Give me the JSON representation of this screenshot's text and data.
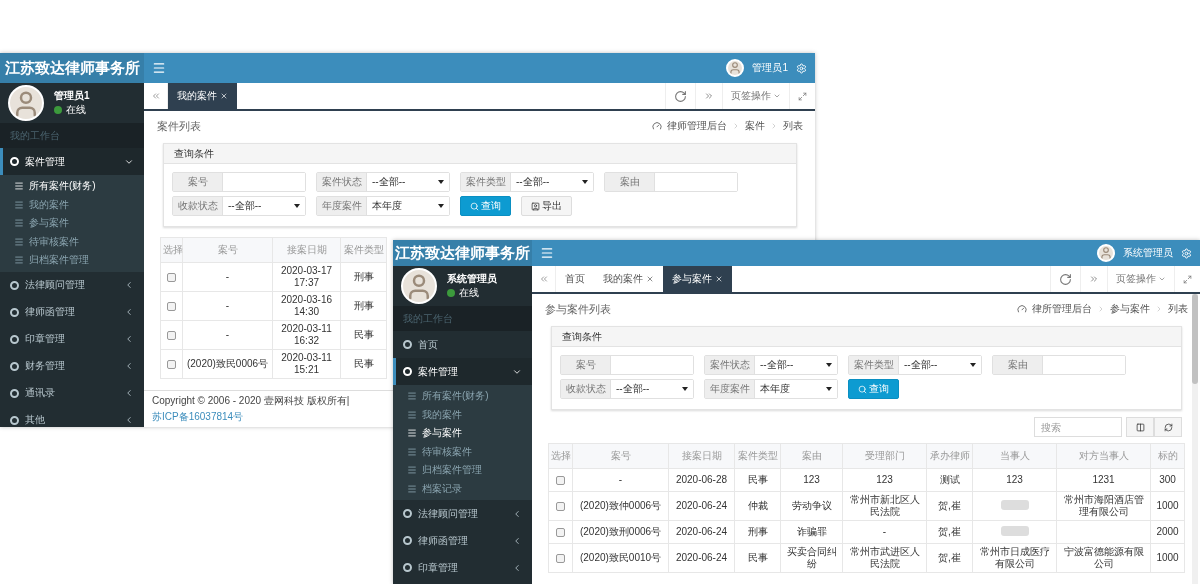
{
  "windows": [
    {
      "brand": "江苏致达律师事务所",
      "header_user": "管理员1",
      "user": {
        "name": "管理员1",
        "status": "在线",
        "online": true
      },
      "workspace_label": "我的工作台",
      "menu": [
        {
          "label": "案件管理",
          "selected": true,
          "expanded": true,
          "children": [
            {
              "label": "所有案件(财务)",
              "selected": true
            },
            {
              "label": "我的案件",
              "selected": false
            },
            {
              "label": "参与案件",
              "selected": false
            },
            {
              "label": "待审核案件",
              "selected": false
            },
            {
              "label": "归档案件管理",
              "selected": false
            }
          ]
        },
        {
          "label": "法律顾问管理",
          "selected": false,
          "expanded": false
        },
        {
          "label": "律师函管理",
          "selected": false,
          "expanded": false
        },
        {
          "label": "印章管理",
          "selected": false,
          "expanded": false
        },
        {
          "label": "财务管理",
          "selected": false,
          "expanded": false
        },
        {
          "label": "通讯录",
          "selected": false,
          "expanded": false
        },
        {
          "label": "其他",
          "selected": false,
          "expanded": false
        }
      ],
      "tabs": [
        {
          "label": "我的案件",
          "selected": true,
          "closable": true
        }
      ],
      "tab_actions": "页签操作",
      "page_title": "案件列表",
      "breadcrumb": [
        "律师管理后台",
        "案件",
        "列表"
      ],
      "query": {
        "title": "查询条件",
        "rows": [
          [
            {
              "kind": "input",
              "label": "案号"
            },
            {
              "kind": "select",
              "label": "案件状态",
              "value": "--全部--"
            },
            {
              "kind": "select",
              "label": "案件类型",
              "value": "--全部--"
            },
            {
              "kind": "input",
              "label": "案由"
            }
          ],
          [
            {
              "kind": "select",
              "label": "收款状态",
              "value": "--全部--"
            },
            {
              "kind": "select",
              "label": "年度案件",
              "value": "本年度"
            },
            {
              "kind": "search_button",
              "label": "查询"
            },
            {
              "kind": "export_button",
              "label": "导出"
            }
          ]
        ]
      },
      "table": {
        "columns": [
          "选择",
          "案号",
          "接案日期",
          "案件类型"
        ],
        "rows": [
          {
            "cells": [
              {
                "kind": "checkbox",
                "checked": false
              },
              "-",
              "2020-03-17 17:37",
              "刑事"
            ]
          },
          {
            "cells": [
              {
                "kind": "checkbox",
                "checked": false
              },
              "-",
              "2020-03-16 14:30",
              "刑事"
            ]
          },
          {
            "cells": [
              {
                "kind": "checkbox",
                "checked": false
              },
              "-",
              "2020-03-11 16:32",
              "民事"
            ]
          },
          {
            "cells": [
              {
                "kind": "checkbox",
                "checked": false
              },
              "(2020)致民0006号",
              "2020-03-11 15:21",
              "民事"
            ]
          }
        ]
      },
      "footer": {
        "text": "Copyright © 2006 - 2020 壹网科技 版权所有|",
        "link": "苏ICP备16037814号"
      }
    },
    {
      "brand": "江苏致达律师事务所",
      "header_user": "系统管理员",
      "user": {
        "name": "系统管理员",
        "status": "在线",
        "online": true
      },
      "workspace_label": "我的工作台",
      "menu": [
        {
          "label": "首页",
          "selected": false
        },
        {
          "label": "案件管理",
          "selected": true,
          "expanded": true,
          "children": [
            {
              "label": "所有案件(财务)",
              "selected": false
            },
            {
              "label": "我的案件",
              "selected": false
            },
            {
              "label": "参与案件",
              "selected": true
            },
            {
              "label": "待审核案件",
              "selected": false
            },
            {
              "label": "归档案件管理",
              "selected": false
            },
            {
              "label": "档案记录",
              "selected": false
            }
          ]
        },
        {
          "label": "法律顾问管理",
          "selected": false,
          "expanded": false
        },
        {
          "label": "律师函管理",
          "selected": false,
          "expanded": false
        },
        {
          "label": "印章管理",
          "selected": false,
          "expanded": false
        }
      ],
      "tabs": [
        {
          "label": "首页",
          "selected": false,
          "closable": false
        },
        {
          "label": "我的案件",
          "selected": false,
          "closable": true
        },
        {
          "label": "参与案件",
          "selected": true,
          "closable": true
        }
      ],
      "tab_actions": "页签操作",
      "page_title": "参与案件列表",
      "breadcrumb": [
        "律所管理后台",
        "参与案件",
        "列表"
      ],
      "query": {
        "title": "查询条件",
        "rows": [
          [
            {
              "kind": "input",
              "label": "案号"
            },
            {
              "kind": "select",
              "label": "案件状态",
              "value": "--全部--"
            },
            {
              "kind": "select",
              "label": "案件类型",
              "value": "--全部--"
            },
            {
              "kind": "input",
              "label": "案由"
            }
          ],
          [
            {
              "kind": "select",
              "label": "收款状态",
              "value": "--全部--"
            },
            {
              "kind": "select",
              "label": "年度案件",
              "value": "本年度"
            },
            {
              "kind": "search_button",
              "label": "查询"
            }
          ]
        ]
      },
      "table_search": {
        "placeholder": "搜索"
      },
      "table": {
        "columns": [
          "选择",
          "案号",
          "接案日期",
          "案件类型",
          "案由",
          "受理部门",
          "承办律师",
          "当事人",
          "对方当事人",
          "标的"
        ],
        "rows": [
          {
            "cells": [
              {
                "kind": "checkbox",
                "checked": false
              },
              "-",
              "2020-06-28",
              "民事",
              "123",
              "123",
              "测试",
              "123",
              "1231",
              "300"
            ]
          },
          {
            "cells": [
              {
                "kind": "checkbox",
                "checked": false
              },
              "(2020)致仲0006号",
              "2020-06-24",
              "仲裁",
              "劳动争议",
              "常州市新北区人民法院",
              "贺,崔",
              {
                "kind": "blurred"
              },
              "常州市海阳酒店管理有限公司",
              "1000"
            ]
          },
          {
            "cells": [
              {
                "kind": "checkbox",
                "checked": false
              },
              "(2020)致刑0006号",
              "2020-06-24",
              "刑事",
              "诈骗罪",
              "-",
              "贺,崔",
              {
                "kind": "blurred"
              },
              null,
              "2000"
            ]
          },
          {
            "cells": [
              {
                "kind": "checkbox",
                "checked": false
              },
              "(2020)致民0010号",
              "2020-06-24",
              "民事",
              "买卖合同纠纷",
              "常州市武进区人民法院",
              "贺,崔",
              "常州市日成医疗有限公司",
              "宁波富德能源有限公司",
              "1000"
            ]
          }
        ]
      }
    }
  ]
}
